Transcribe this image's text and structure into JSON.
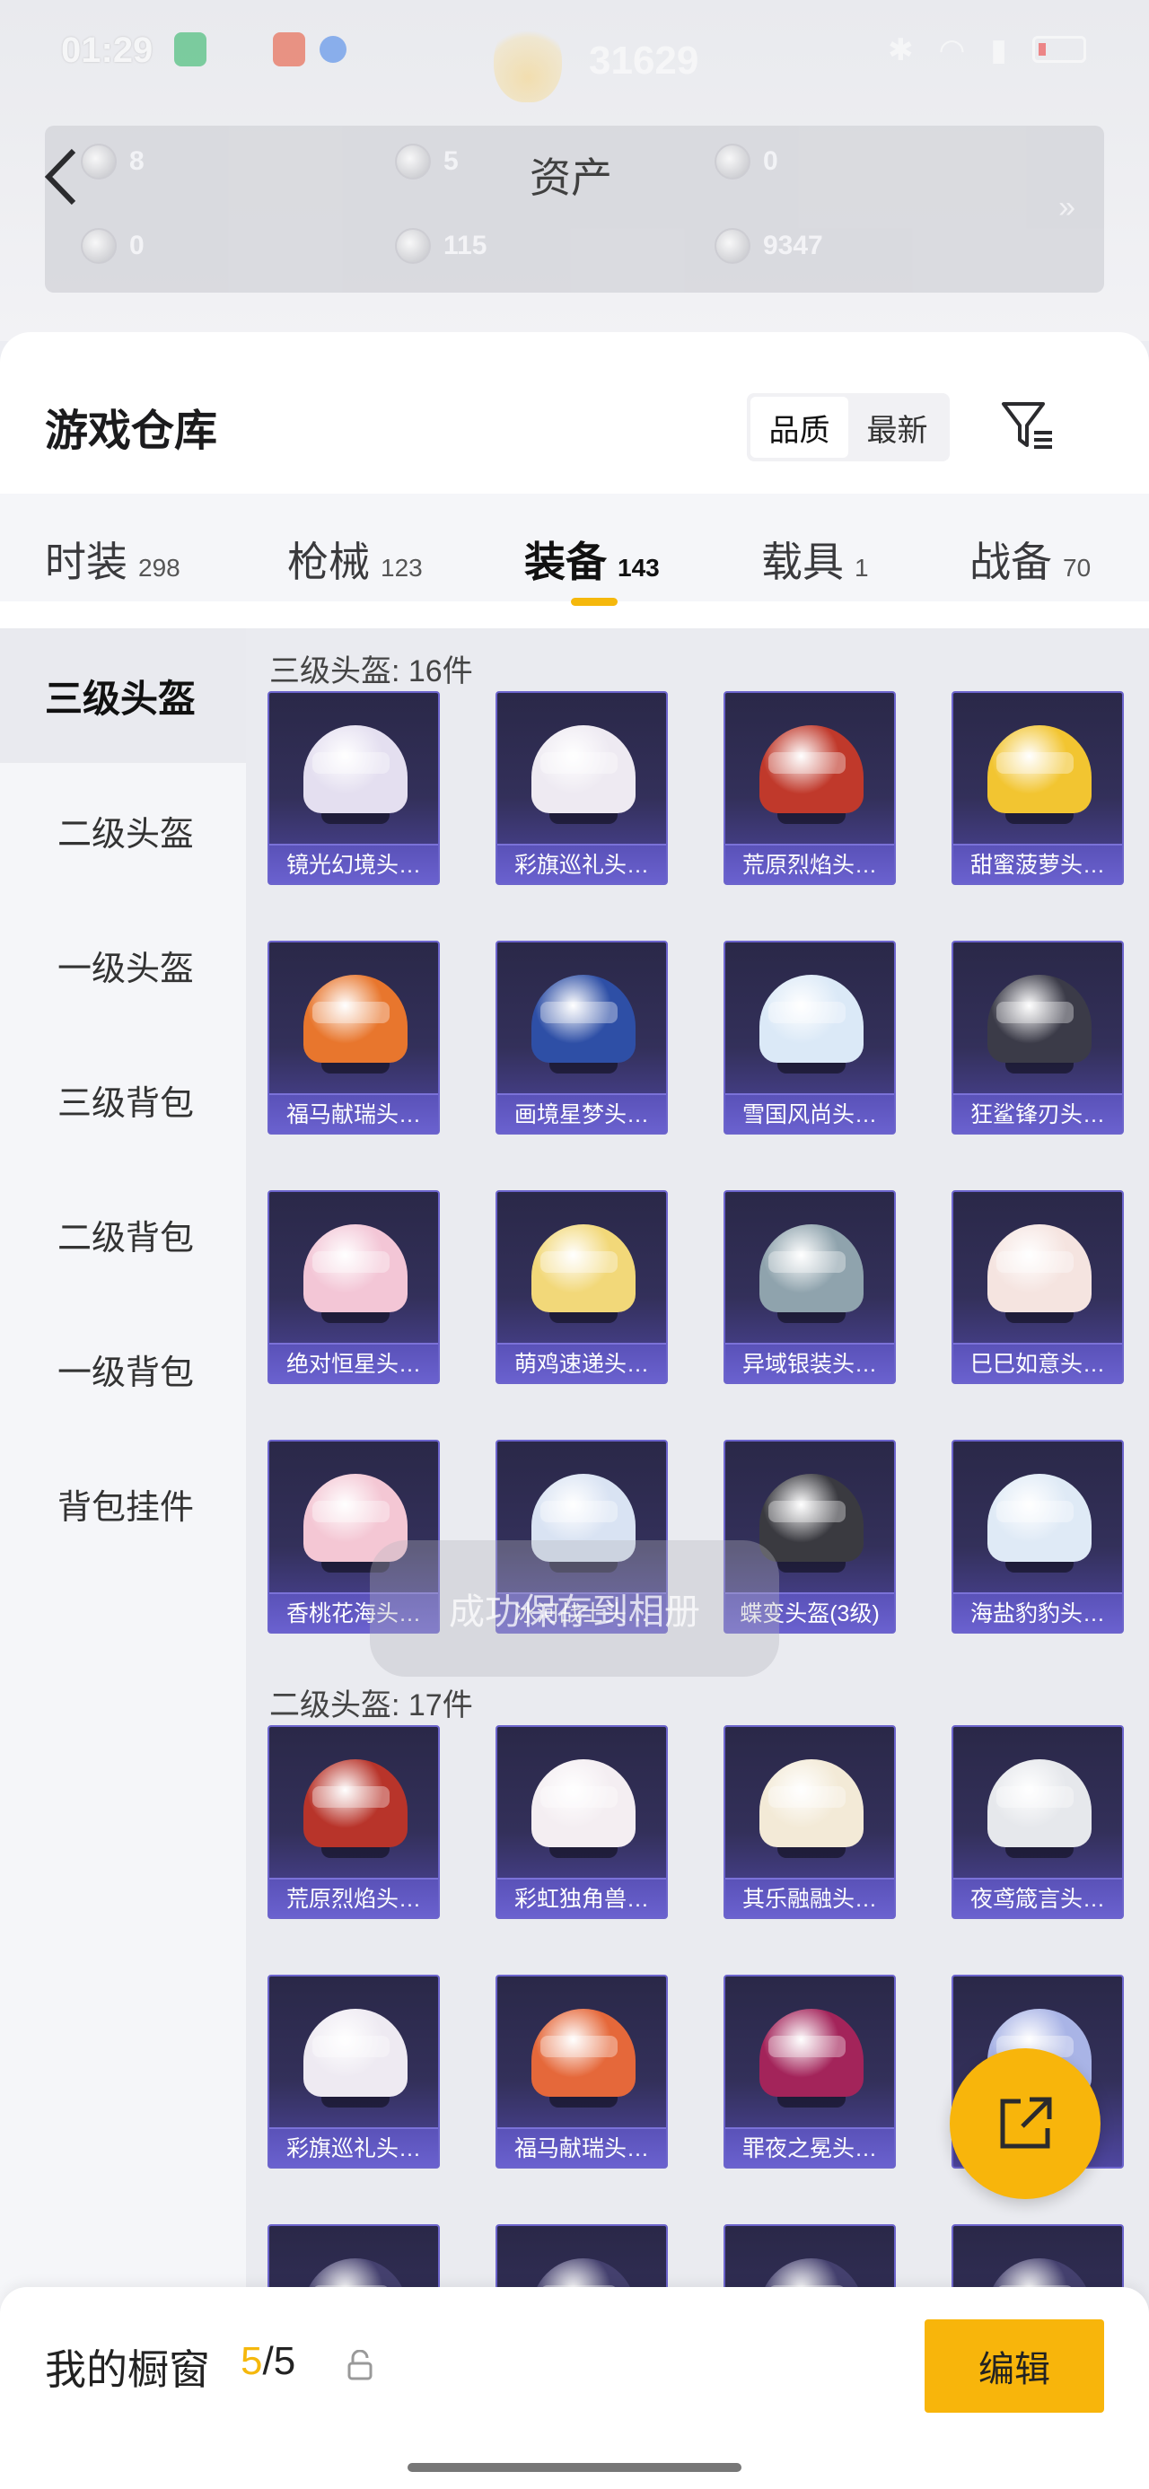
{
  "status_bar": {
    "time": "01:29"
  },
  "header_blur": {
    "score": "31629",
    "assets_title": "资产",
    "assets": [
      {
        "value": "8",
        "color": "#c6e0d8"
      },
      {
        "value": "5",
        "color": "#d0d0d6"
      },
      {
        "value": "0",
        "color": "#e6dcc4"
      },
      {
        "value": "0",
        "color": "#bfe0de"
      },
      {
        "value": "115",
        "color": "#e4e4e8"
      },
      {
        "value": "9347",
        "color": "#e8e2d6"
      }
    ]
  },
  "page": {
    "title": "游戏仓库"
  },
  "sort": {
    "options": [
      "品质",
      "最新"
    ],
    "active": 0
  },
  "tabs": [
    {
      "label": "时装",
      "count": "298"
    },
    {
      "label": "枪械",
      "count": "123"
    },
    {
      "label": "装备",
      "count": "143"
    },
    {
      "label": "载具",
      "count": "1"
    },
    {
      "label": "战备",
      "count": "70"
    }
  ],
  "active_tab": 2,
  "sidebar": {
    "items": [
      "三级头盔",
      "二级头盔",
      "一级头盔",
      "三级背包",
      "二级背包",
      "一级背包",
      "背包挂件"
    ],
    "active": 0
  },
  "sections": [
    {
      "label": "三级头盔: 16件",
      "items": [
        {
          "name": "镜光幻境头…",
          "color": "#e4dff0"
        },
        {
          "name": "彩旗巡礼头…",
          "color": "#eeeaf2"
        },
        {
          "name": "荒原烈焰头…",
          "color": "#c0392b"
        },
        {
          "name": "甜蜜菠萝头…",
          "color": "#f2c531"
        },
        {
          "name": "福马献瑞头…",
          "color": "#e8762d"
        },
        {
          "name": "画境星梦头…",
          "color": "#2e4fa6"
        },
        {
          "name": "雪国风尚头…",
          "color": "#dbe9f7"
        },
        {
          "name": "狂鲨锋刃头…",
          "color": "#3b3b48"
        },
        {
          "name": "绝对恒星头…",
          "color": "#f3c6d6"
        },
        {
          "name": "萌鸡速递头…",
          "color": "#f2d879"
        },
        {
          "name": "异域银装头…",
          "color": "#8fa3ad"
        },
        {
          "name": "巳巳如意头…",
          "color": "#f5e4e0"
        },
        {
          "name": "香桃花海头…",
          "color": "#f4c7d4"
        },
        {
          "name": "冰河战士头…",
          "color": "#d9e3f3"
        },
        {
          "name": "蝶变头盔(3级)",
          "color": "#3a3a40"
        },
        {
          "name": "海盐豹豹头…",
          "color": "#dfeaf6"
        }
      ]
    },
    {
      "label": "二级头盔: 17件",
      "items": [
        {
          "name": "荒原烈焰头…",
          "color": "#b8342a"
        },
        {
          "name": "彩虹独角兽…",
          "color": "#f4eef2"
        },
        {
          "name": "其乐融融头…",
          "color": "#f3ead7"
        },
        {
          "name": "夜鸢箴言头…",
          "color": "#e6e8ec"
        },
        {
          "name": "彩旗巡礼头…",
          "color": "#eeeaf2"
        },
        {
          "name": "福马献瑞头…",
          "color": "#e5683a"
        },
        {
          "name": "罪夜之冕头…",
          "color": "#a3245a"
        },
        {
          "name": "",
          "color": "#a9b4e6"
        },
        {
          "name": "",
          "color": "#44406e"
        },
        {
          "name": "",
          "color": "#44406e"
        },
        {
          "name": "",
          "color": "#44406e"
        },
        {
          "name": "",
          "color": "#44406e"
        }
      ]
    }
  ],
  "toast": {
    "text": "成功保存到相册"
  },
  "showcase": {
    "label": "我的橱窗",
    "current": "5",
    "total": "/5",
    "edit_label": "编辑"
  },
  "colors": {
    "accent": "#f8b50b",
    "card_top": "#2a2848",
    "card_bottom": "#6a61cf"
  }
}
